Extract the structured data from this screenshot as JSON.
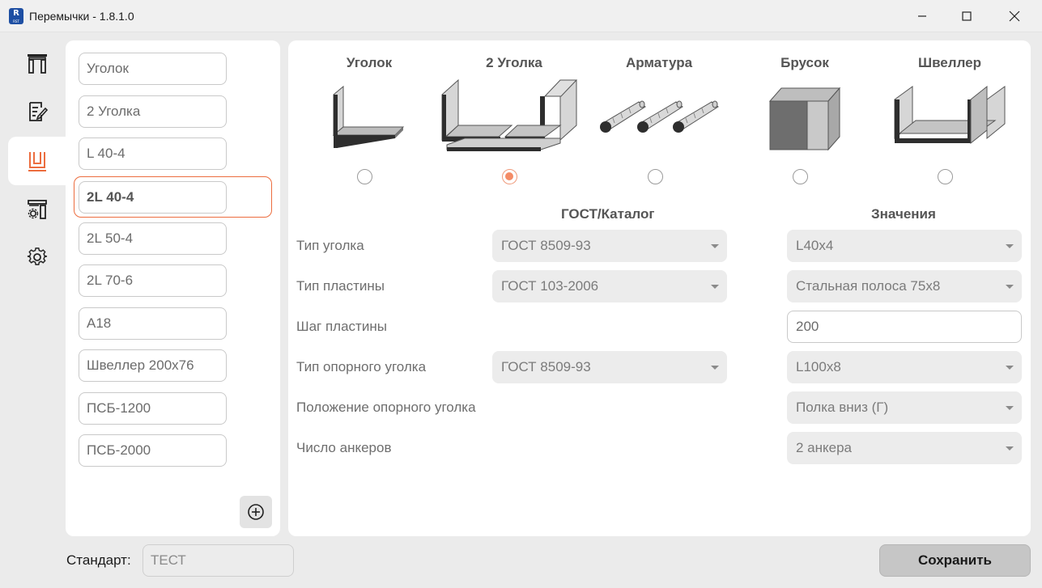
{
  "window": {
    "app_icon_letter": "R",
    "app_icon_sub": "RST",
    "title": "Перемычки - 1.8.1.0"
  },
  "nav": {
    "items": [
      {
        "name": "lintel-icon",
        "active": false
      },
      {
        "name": "edit-document-icon",
        "active": false
      },
      {
        "name": "bracket-icon",
        "active": true
      },
      {
        "name": "settings-panel-icon",
        "active": false
      },
      {
        "name": "gear-icon",
        "active": false
      }
    ],
    "accent_color": "#ec6d3f"
  },
  "list": {
    "items": [
      "Уголок",
      "2 Уголка",
      "L 40-4",
      "2L 40-4",
      "2L 50-4",
      "2L 70-6",
      "A18",
      "Швеллер 200x76",
      "ПСБ-1200",
      "ПСБ-2000"
    ],
    "selected_index": 3
  },
  "types": [
    {
      "title": "Уголок",
      "selected": false
    },
    {
      "title": "2 Уголка",
      "selected": true
    },
    {
      "title": "Арматура",
      "selected": false
    },
    {
      "title": "Брусок",
      "selected": false
    },
    {
      "title": "Швеллер",
      "selected": false
    }
  ],
  "form": {
    "col_catalog": "ГОСТ/Каталог",
    "col_values": "Значения",
    "rows": [
      {
        "label": "Тип уголка",
        "catalog": "ГОСТ 8509-93",
        "value": "L40x4"
      },
      {
        "label": "Тип пластины",
        "catalog": "ГОСТ 103-2006",
        "value": "Стальная полоса 75x8"
      },
      {
        "label": "Шаг пластины",
        "catalog": "",
        "value": "200"
      },
      {
        "label": "Тип опорного уголка",
        "catalog": "ГОСТ 8509-93",
        "value": "L100x8"
      },
      {
        "label": "Положение опорного уголка",
        "catalog": "",
        "value": "Полка вниз (Г)"
      },
      {
        "label": "Число анкеров",
        "catalog": "",
        "value": "2 анкера"
      }
    ]
  },
  "footer": {
    "standard_label": "Стандарт:",
    "standard_value": "ТЕСТ",
    "save_label": "Сохранить"
  }
}
